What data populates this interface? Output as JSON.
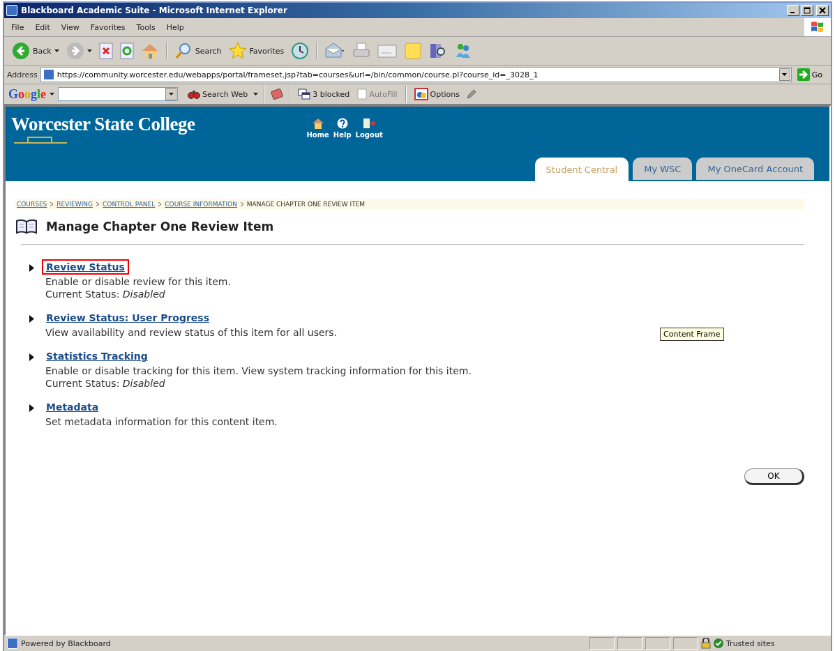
{
  "window": {
    "title": "Blackboard Academic Suite - Microsoft Internet Explorer"
  },
  "menu_bar": [
    {
      "label": "File"
    },
    {
      "label": "Edit"
    },
    {
      "label": "View"
    },
    {
      "label": "Favorites"
    },
    {
      "label": "Tools"
    },
    {
      "label": "Help"
    }
  ],
  "toolbar": [
    {
      "kind": "back",
      "label": "Back"
    },
    {
      "kind": "forward"
    },
    {
      "kind": "stop"
    },
    {
      "kind": "refresh"
    },
    {
      "kind": "home"
    },
    {
      "kind": "search",
      "label": "Search"
    },
    {
      "kind": "favorites",
      "label": "Favorites"
    },
    {
      "kind": "history"
    },
    {
      "kind": "mail"
    },
    {
      "kind": "print"
    },
    {
      "kind": "edit"
    },
    {
      "kind": "note"
    },
    {
      "kind": "research"
    },
    {
      "kind": "messenger"
    }
  ],
  "address_bar": {
    "label": "Address",
    "value": "https://community.worcester.edu/webapps/portal/frameset.jsp?tab=courses&url=/bin/common/course.pl?course_id=_3028_1",
    "go": "Go"
  },
  "google_bar": {
    "logo": "Google",
    "search_button": "Search Web",
    "blocked": "3 blocked",
    "autofill": {
      "label": "AutoFill",
      "disabled": true
    },
    "options": "Options"
  },
  "site_header": {
    "college": "Worcester State College",
    "links": [
      {
        "kind": "home",
        "label": "Home"
      },
      {
        "kind": "help",
        "label": "Help"
      },
      {
        "kind": "logout",
        "label": "Logout"
      }
    ],
    "tabs": [
      {
        "label": "Student Central",
        "selected": true
      },
      {
        "label": "My WSC",
        "selected": false
      },
      {
        "label": "My OneCard Account",
        "selected": false
      }
    ]
  },
  "breadcrumb": [
    {
      "label": "COURSES",
      "link": true
    },
    {
      "label": "REVIEWING",
      "link": true
    },
    {
      "label": "CONTROL PANEL",
      "link": true
    },
    {
      "label": "COURSE INFORMATION",
      "link": true
    },
    {
      "label": "MANAGE CHAPTER ONE REVIEW ITEM",
      "link": false
    }
  ],
  "page_title": "Manage Chapter One Review Item",
  "items": [
    {
      "title": "Review Status",
      "highlighted": true,
      "description": "Enable or disable review for this item.",
      "status_label": "Current Status:",
      "status_value": "Disabled"
    },
    {
      "title": "Review Status: User Progress",
      "highlighted": false,
      "description": "View availability and review status of this item for all users."
    },
    {
      "title": "Statistics Tracking",
      "highlighted": false,
      "description": "Enable or disable tracking for this item. View system tracking information for this item.",
      "status_label": "Current Status:",
      "status_value": "Disabled"
    },
    {
      "title": "Metadata",
      "highlighted": false,
      "description": "Set metadata information for this content item."
    }
  ],
  "tooltip": "Content Frame",
  "ok_button": "OK",
  "status_bar": {
    "text": "Powered by Blackboard",
    "zone": "Trusted sites"
  }
}
